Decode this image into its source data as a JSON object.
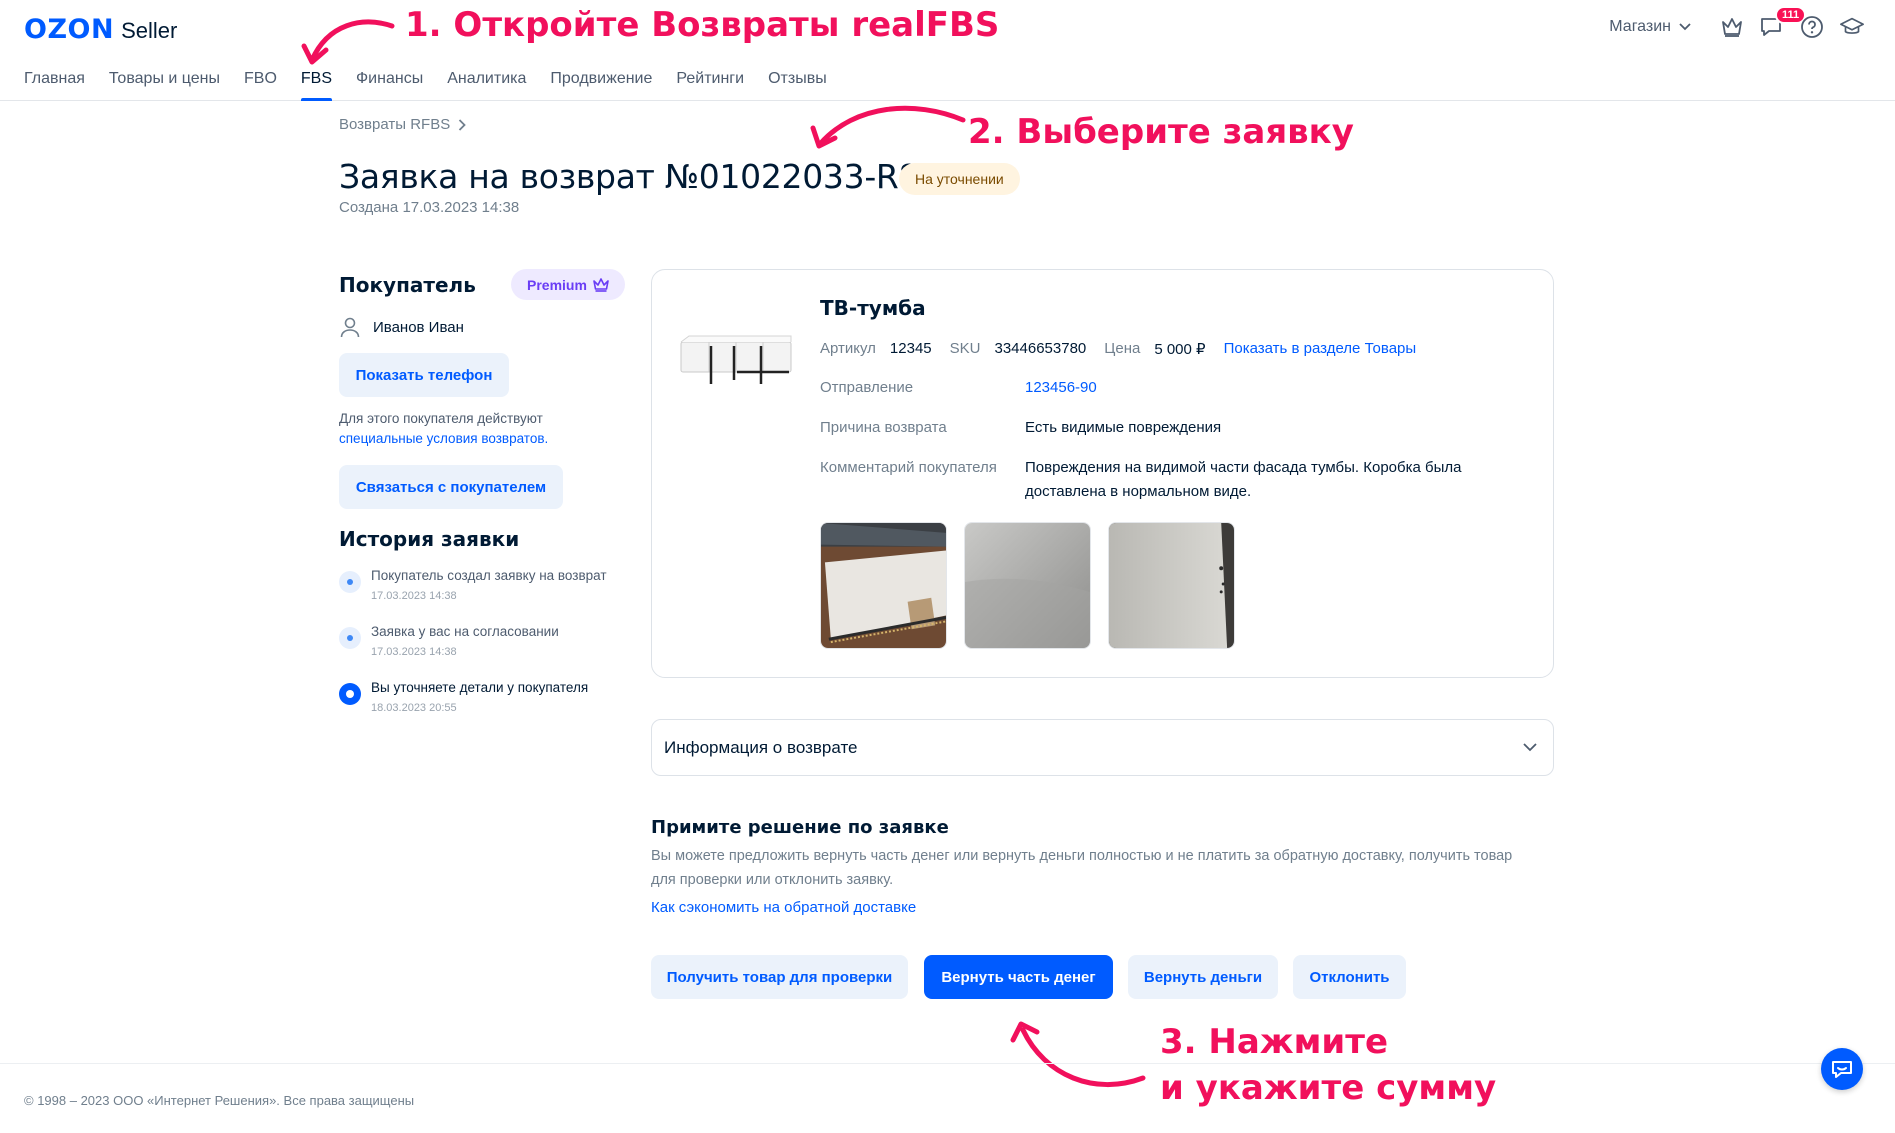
{
  "brand": {
    "logo_text": "OZON",
    "product": "Seller",
    "primary_color": "#005bff",
    "annotation_color": "#f1105c"
  },
  "nav": {
    "items": [
      {
        "label": "Главная"
      },
      {
        "label": "Товары и цены"
      },
      {
        "label": "FBO"
      },
      {
        "label": "FBS",
        "active": true
      },
      {
        "label": "Финансы"
      },
      {
        "label": "Аналитика"
      },
      {
        "label": "Продвижение"
      },
      {
        "label": "Рейтинги"
      },
      {
        "label": "Отзывы"
      }
    ]
  },
  "header": {
    "shop_label": "Магазин",
    "chat_badge": "111",
    "icons": [
      "crown-icon",
      "chat-icon",
      "help-icon",
      "education-icon"
    ]
  },
  "annotations": {
    "step1": "1. Откройте Возвраты realFBS",
    "step2": "2. Выберите заявку",
    "step3_line1": "3. Нажмите",
    "step3_line2": "и укажите сумму"
  },
  "page": {
    "breadcrumb": "Возвраты RFBS",
    "title": "Заявка на возврат №01022033-R8",
    "status": "На уточнении",
    "created": "Создана 17.03.2023 14:38"
  },
  "buyer": {
    "heading": "Покупатель",
    "badge": "Premium",
    "name": "Иванов Иван",
    "show_phone": "Показать телефон",
    "note_text": "Для этого покупателя действуют",
    "note_link": "специальные условия возвратов.",
    "contact_button": "Связаться с покупателем"
  },
  "history": {
    "heading": "История заявки",
    "items": [
      {
        "text": "Покупатель создал заявку на возврат",
        "date": "17.03.2023 14:38",
        "active": false
      },
      {
        "text": "Заявка у вас на согласовании",
        "date": "17.03.2023 14:38",
        "active": false
      },
      {
        "text": "Вы уточняете детали у покупателя",
        "date": "18.03.2023 20:55",
        "active": true
      }
    ]
  },
  "product": {
    "title": "ТВ-тумба",
    "article_label": "Артикул",
    "article": "12345",
    "sku_label": "SKU",
    "sku": "33446653780",
    "price_label": "Цена",
    "price": "5 000 ₽",
    "goods_link": "Показать в разделе Товары",
    "shipment_label": "Отправление",
    "shipment": "123456-90",
    "reason_label": "Причина возврата",
    "reason": "Есть видимые повреждения",
    "comment_label": "Комментарий покупателя",
    "comment": "Повреждения на видимой части фасада тумбы. Коробка была доставлена в нормальном виде."
  },
  "return_info": {
    "label": "Информация о возврате"
  },
  "decision": {
    "title": "Примите решение по заявке",
    "text": "Вы можете предложить вернуть часть денег или вернуть деньги полностью и не платить за обратную доставку, получить товар для проверки или отклонить заявку.",
    "link": "Как сэкономить на обратной доставке",
    "buttons": {
      "inspect": "Получить товар для проверки",
      "partial": "Вернуть часть денег",
      "full": "Вернуть деньги",
      "reject": "Отклонить"
    }
  },
  "footer": {
    "copyright": "© 1998 – 2023 ООО «Интернет Решения». Все права защищены"
  }
}
